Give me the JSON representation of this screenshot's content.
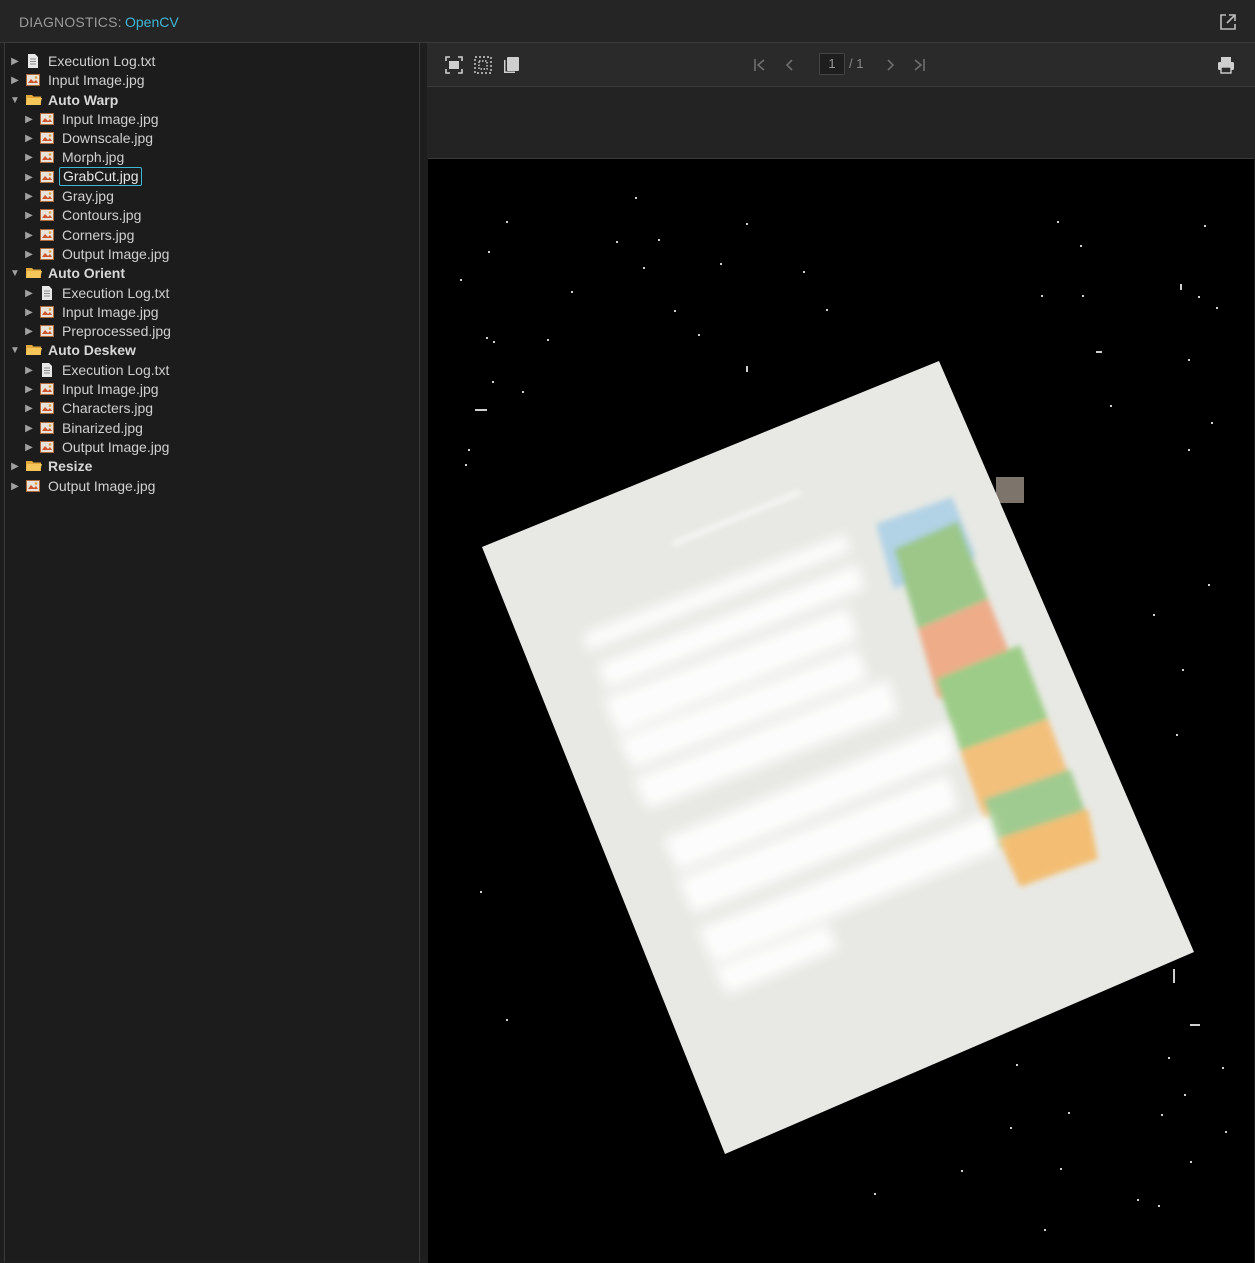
{
  "header": {
    "label": "DIAGNOSTICS:",
    "engine": "OpenCV",
    "popout_icon": "external-link-icon"
  },
  "tree": [
    {
      "id": "r1",
      "label": "Execution Log.txt",
      "type": "file-text",
      "depth": 1,
      "folder": false
    },
    {
      "id": "r2",
      "label": "Input Image.jpg",
      "type": "image",
      "depth": 1,
      "folder": false
    },
    {
      "id": "r3",
      "label": "Auto Warp",
      "type": "folder",
      "depth": 1,
      "folder": true,
      "expanded": true
    },
    {
      "id": "r4",
      "label": "Input Image.jpg",
      "type": "image",
      "depth": 2,
      "folder": false
    },
    {
      "id": "r5",
      "label": "Downscale.jpg",
      "type": "image",
      "depth": 2,
      "folder": false
    },
    {
      "id": "r6",
      "label": "Morph.jpg",
      "type": "image",
      "depth": 2,
      "folder": false
    },
    {
      "id": "r7",
      "label": "GrabCut.jpg",
      "type": "image",
      "depth": 2,
      "folder": false,
      "selected": true
    },
    {
      "id": "r8",
      "label": "Gray.jpg",
      "type": "image",
      "depth": 2,
      "folder": false
    },
    {
      "id": "r9",
      "label": "Contours.jpg",
      "type": "image",
      "depth": 2,
      "folder": false
    },
    {
      "id": "r10",
      "label": "Corners.jpg",
      "type": "image",
      "depth": 2,
      "folder": false
    },
    {
      "id": "r11",
      "label": "Output Image.jpg",
      "type": "image",
      "depth": 2,
      "folder": false
    },
    {
      "id": "r12",
      "label": "Auto Orient",
      "type": "folder",
      "depth": 1,
      "folder": true,
      "expanded": true
    },
    {
      "id": "r13",
      "label": "Execution Log.txt",
      "type": "file-text",
      "depth": 2,
      "folder": false
    },
    {
      "id": "r14",
      "label": "Input Image.jpg",
      "type": "image",
      "depth": 2,
      "folder": false
    },
    {
      "id": "r15",
      "label": "Preprocessed.jpg",
      "type": "image",
      "depth": 2,
      "folder": false
    },
    {
      "id": "r16",
      "label": "Auto Deskew",
      "type": "folder",
      "depth": 1,
      "folder": true,
      "expanded": true
    },
    {
      "id": "r17",
      "label": "Execution Log.txt",
      "type": "file-text",
      "depth": 2,
      "folder": false
    },
    {
      "id": "r18",
      "label": "Input Image.jpg",
      "type": "image",
      "depth": 2,
      "folder": false
    },
    {
      "id": "r19",
      "label": "Characters.jpg",
      "type": "image",
      "depth": 2,
      "folder": false
    },
    {
      "id": "r20",
      "label": "Binarized.jpg",
      "type": "image",
      "depth": 2,
      "folder": false
    },
    {
      "id": "r21",
      "label": "Output Image.jpg",
      "type": "image",
      "depth": 2,
      "folder": false
    },
    {
      "id": "r22",
      "label": "Resize",
      "type": "folder",
      "depth": 1,
      "folder": true,
      "expanded": false
    },
    {
      "id": "r23",
      "label": "Output Image.jpg",
      "type": "image",
      "depth": 1,
      "folder": false
    }
  ],
  "toolbar": {
    "fit_icon": "fit-to-window-icon",
    "actual_size_icon": "actual-size-icon",
    "pages_icon": "copy-pages-icon",
    "first_icon": "first-page-icon",
    "prev_icon": "previous-page-icon",
    "page_current": "1",
    "page_total": "/ 1",
    "next_icon": "next-page-icon",
    "last_icon": "last-page-icon",
    "print_icon": "printer-icon"
  },
  "colors": {
    "accent": "#3fb6d6",
    "background": "#1e1e1e",
    "canvas": "#000000"
  }
}
